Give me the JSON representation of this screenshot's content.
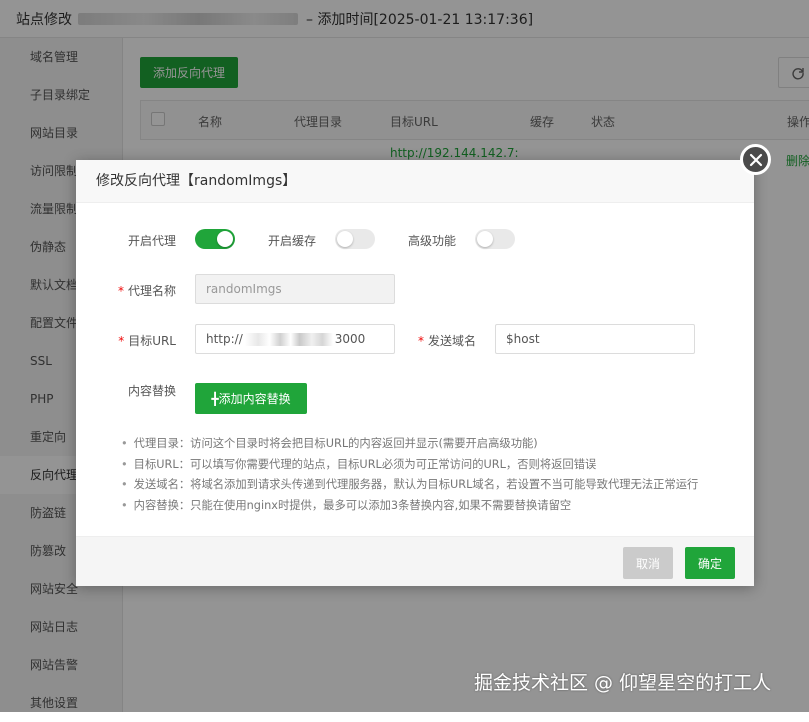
{
  "header": {
    "title_prefix": "站点修改",
    "title_suffix": "– 添加时间[2025-01-21 13:17:36]"
  },
  "sidebar": {
    "items": [
      {
        "label": "域名管理"
      },
      {
        "label": "子目录绑定"
      },
      {
        "label": "网站目录"
      },
      {
        "label": "访问限制"
      },
      {
        "label": "流量限制"
      },
      {
        "label": "伪静态"
      },
      {
        "label": "默认文档"
      },
      {
        "label": "配置文件"
      },
      {
        "label": "SSL"
      },
      {
        "label": "PHP"
      },
      {
        "label": "重定向"
      },
      {
        "label": "反向代理"
      },
      {
        "label": "防盗链"
      },
      {
        "label": "防篡改"
      },
      {
        "label": "网站安全"
      },
      {
        "label": "网站日志"
      },
      {
        "label": "网站告警"
      },
      {
        "label": "其他设置"
      }
    ],
    "active_index": 11
  },
  "toolbar": {
    "add_proxy_label": "添加反向代理",
    "refresh_icon": "refresh-icon"
  },
  "table": {
    "columns": [
      "名称",
      "代理目录",
      "目标URL",
      "缓存",
      "状态",
      "操作"
    ],
    "row": {
      "url": "http://192.144.142.7:",
      "delete_label": "删除"
    }
  },
  "modal": {
    "title": "修改反向代理【randomImgs】",
    "enable_proxy_label": "开启代理",
    "enable_proxy_on": true,
    "enable_cache_label": "开启缓存",
    "enable_cache_on": false,
    "advanced_label": "高级功能",
    "advanced_on": false,
    "proxy_name_label": "代理名称",
    "proxy_name_value": "randomImgs",
    "target_url_label": "目标URL",
    "target_url_prefix": "http://",
    "target_url_suffix": "3000",
    "send_domain_label": "发送域名",
    "send_domain_value": "$host",
    "content_replace_label": "内容替换",
    "add_content_replace_label": "╋添加内容替换",
    "help": [
      "代理目录：访问这个目录时将会把目标URL的内容返回并显示(需要开启高级功能)",
      "目标URL：可以填写你需要代理的站点，目标URL必须为可正常访问的URL，否则将返回错误",
      "发送域名：将域名添加到请求头传递到代理服务器，默认为目标URL域名，若设置不当可能导致代理无法正常运行",
      "内容替换：只能在使用nginx时提供，最多可以添加3条替换内容,如果不需要替换请留空"
    ],
    "cancel_label": "取消",
    "ok_label": "确定"
  },
  "watermark": "掘金技术社区 @ 仰望星空的打工人",
  "colors": {
    "accent": "#20a53a",
    "required": "#ef0808",
    "overlay": "rgba(0,0,0,0.42)"
  }
}
